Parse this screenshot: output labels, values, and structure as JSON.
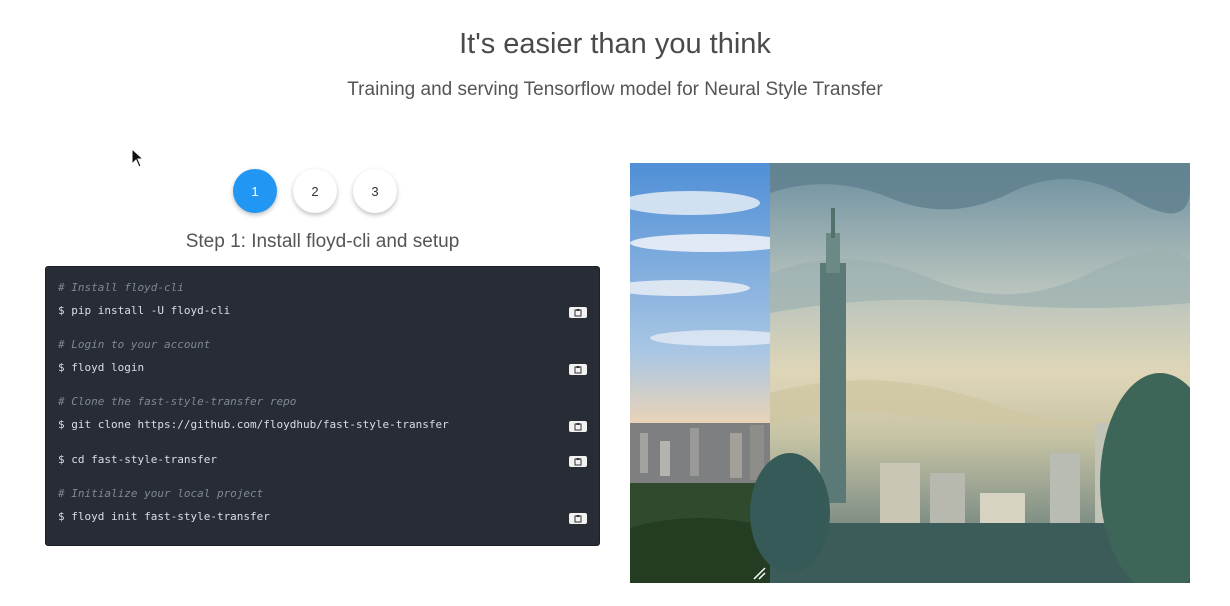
{
  "hero": {
    "title": "It's easier than you think",
    "subtitle": "Training and serving Tensorflow model for Neural Style Transfer"
  },
  "steps": {
    "buttons": [
      "1",
      "2",
      "3"
    ],
    "active_index": 0,
    "title": "Step 1: Install floyd-cli and setup"
  },
  "code": {
    "blocks": [
      {
        "comment": "# Install floyd-cli",
        "command": "$ pip install -U floyd-cli"
      },
      {
        "comment": "# Login to your account",
        "command": "$ floyd login"
      },
      {
        "comment": "# Clone the fast-style-transfer repo",
        "command": "$ git clone https://github.com/floydhub/fast-style-transfer"
      },
      {
        "comment": "",
        "command": "$ cd fast-style-transfer"
      },
      {
        "comment": "# Initialize your local project",
        "command": "$ floyd init fast-style-transfer"
      }
    ],
    "copy_icon": "clipboard-icon"
  },
  "comparison": {
    "left_label_icon": "original-photo",
    "right_label_icon": "stylized-photo"
  },
  "colors": {
    "accent": "#2196f3",
    "code_bg": "#282c34"
  }
}
